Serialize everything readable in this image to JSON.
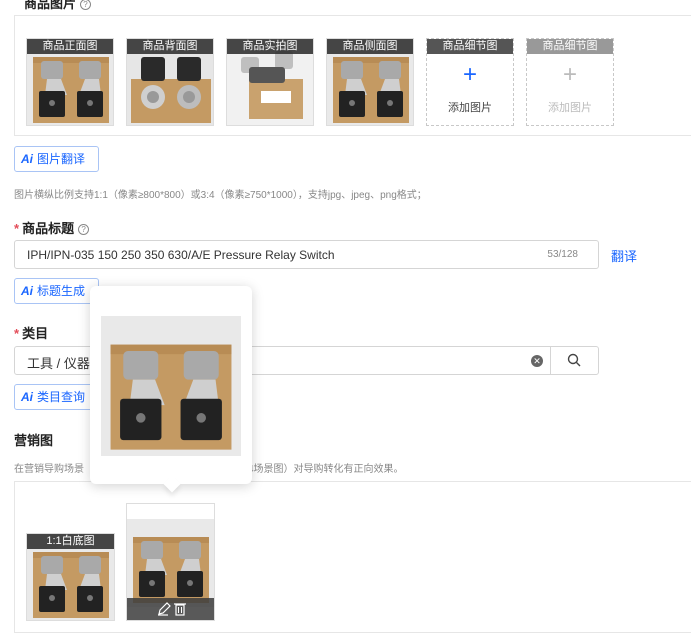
{
  "images_section": {
    "title": "商品图片",
    "thumbs": [
      {
        "label": "商品正面图",
        "variant": "front"
      },
      {
        "label": "商品背面图",
        "variant": "back"
      },
      {
        "label": "商品实拍图",
        "variant": "real"
      },
      {
        "label": "商品侧面图",
        "variant": "side"
      }
    ],
    "slots": [
      {
        "label": "商品细节图",
        "action": "添加图片",
        "disabled": false
      },
      {
        "label": "商品细节图",
        "action": "添加图片",
        "disabled": true
      }
    ],
    "translate_button": "图片翻译",
    "hint": "图片横纵比例支持1:1（像素≥800*800）或3:4（像素≥750*1000），支持jpg、jpeg、png格式；"
  },
  "title_section": {
    "label": "商品标题",
    "value": "IPH/IPN-035 150 250 350 630/A/E Pressure Relay Switch",
    "count": "53/128",
    "translate_link": "翻译",
    "generate_button": "标题生成"
  },
  "category_section": {
    "label": "类目",
    "value": "工具 / 仪器",
    "query_button": "类目查询"
  },
  "marketing_section": {
    "label": "营销图",
    "hint_left": "在营销导购场景",
    "hint_right": "4场景图）对导购转化有正向效果。",
    "white_bg_label": "1:1白底图"
  },
  "ai_tag": "Ai",
  "colors": {
    "accent": "#1a66ff",
    "required": "#e34d59"
  },
  "icons": [
    "question-icon",
    "plus-icon",
    "clear-icon",
    "search-icon",
    "edit-icon",
    "trash-icon"
  ]
}
